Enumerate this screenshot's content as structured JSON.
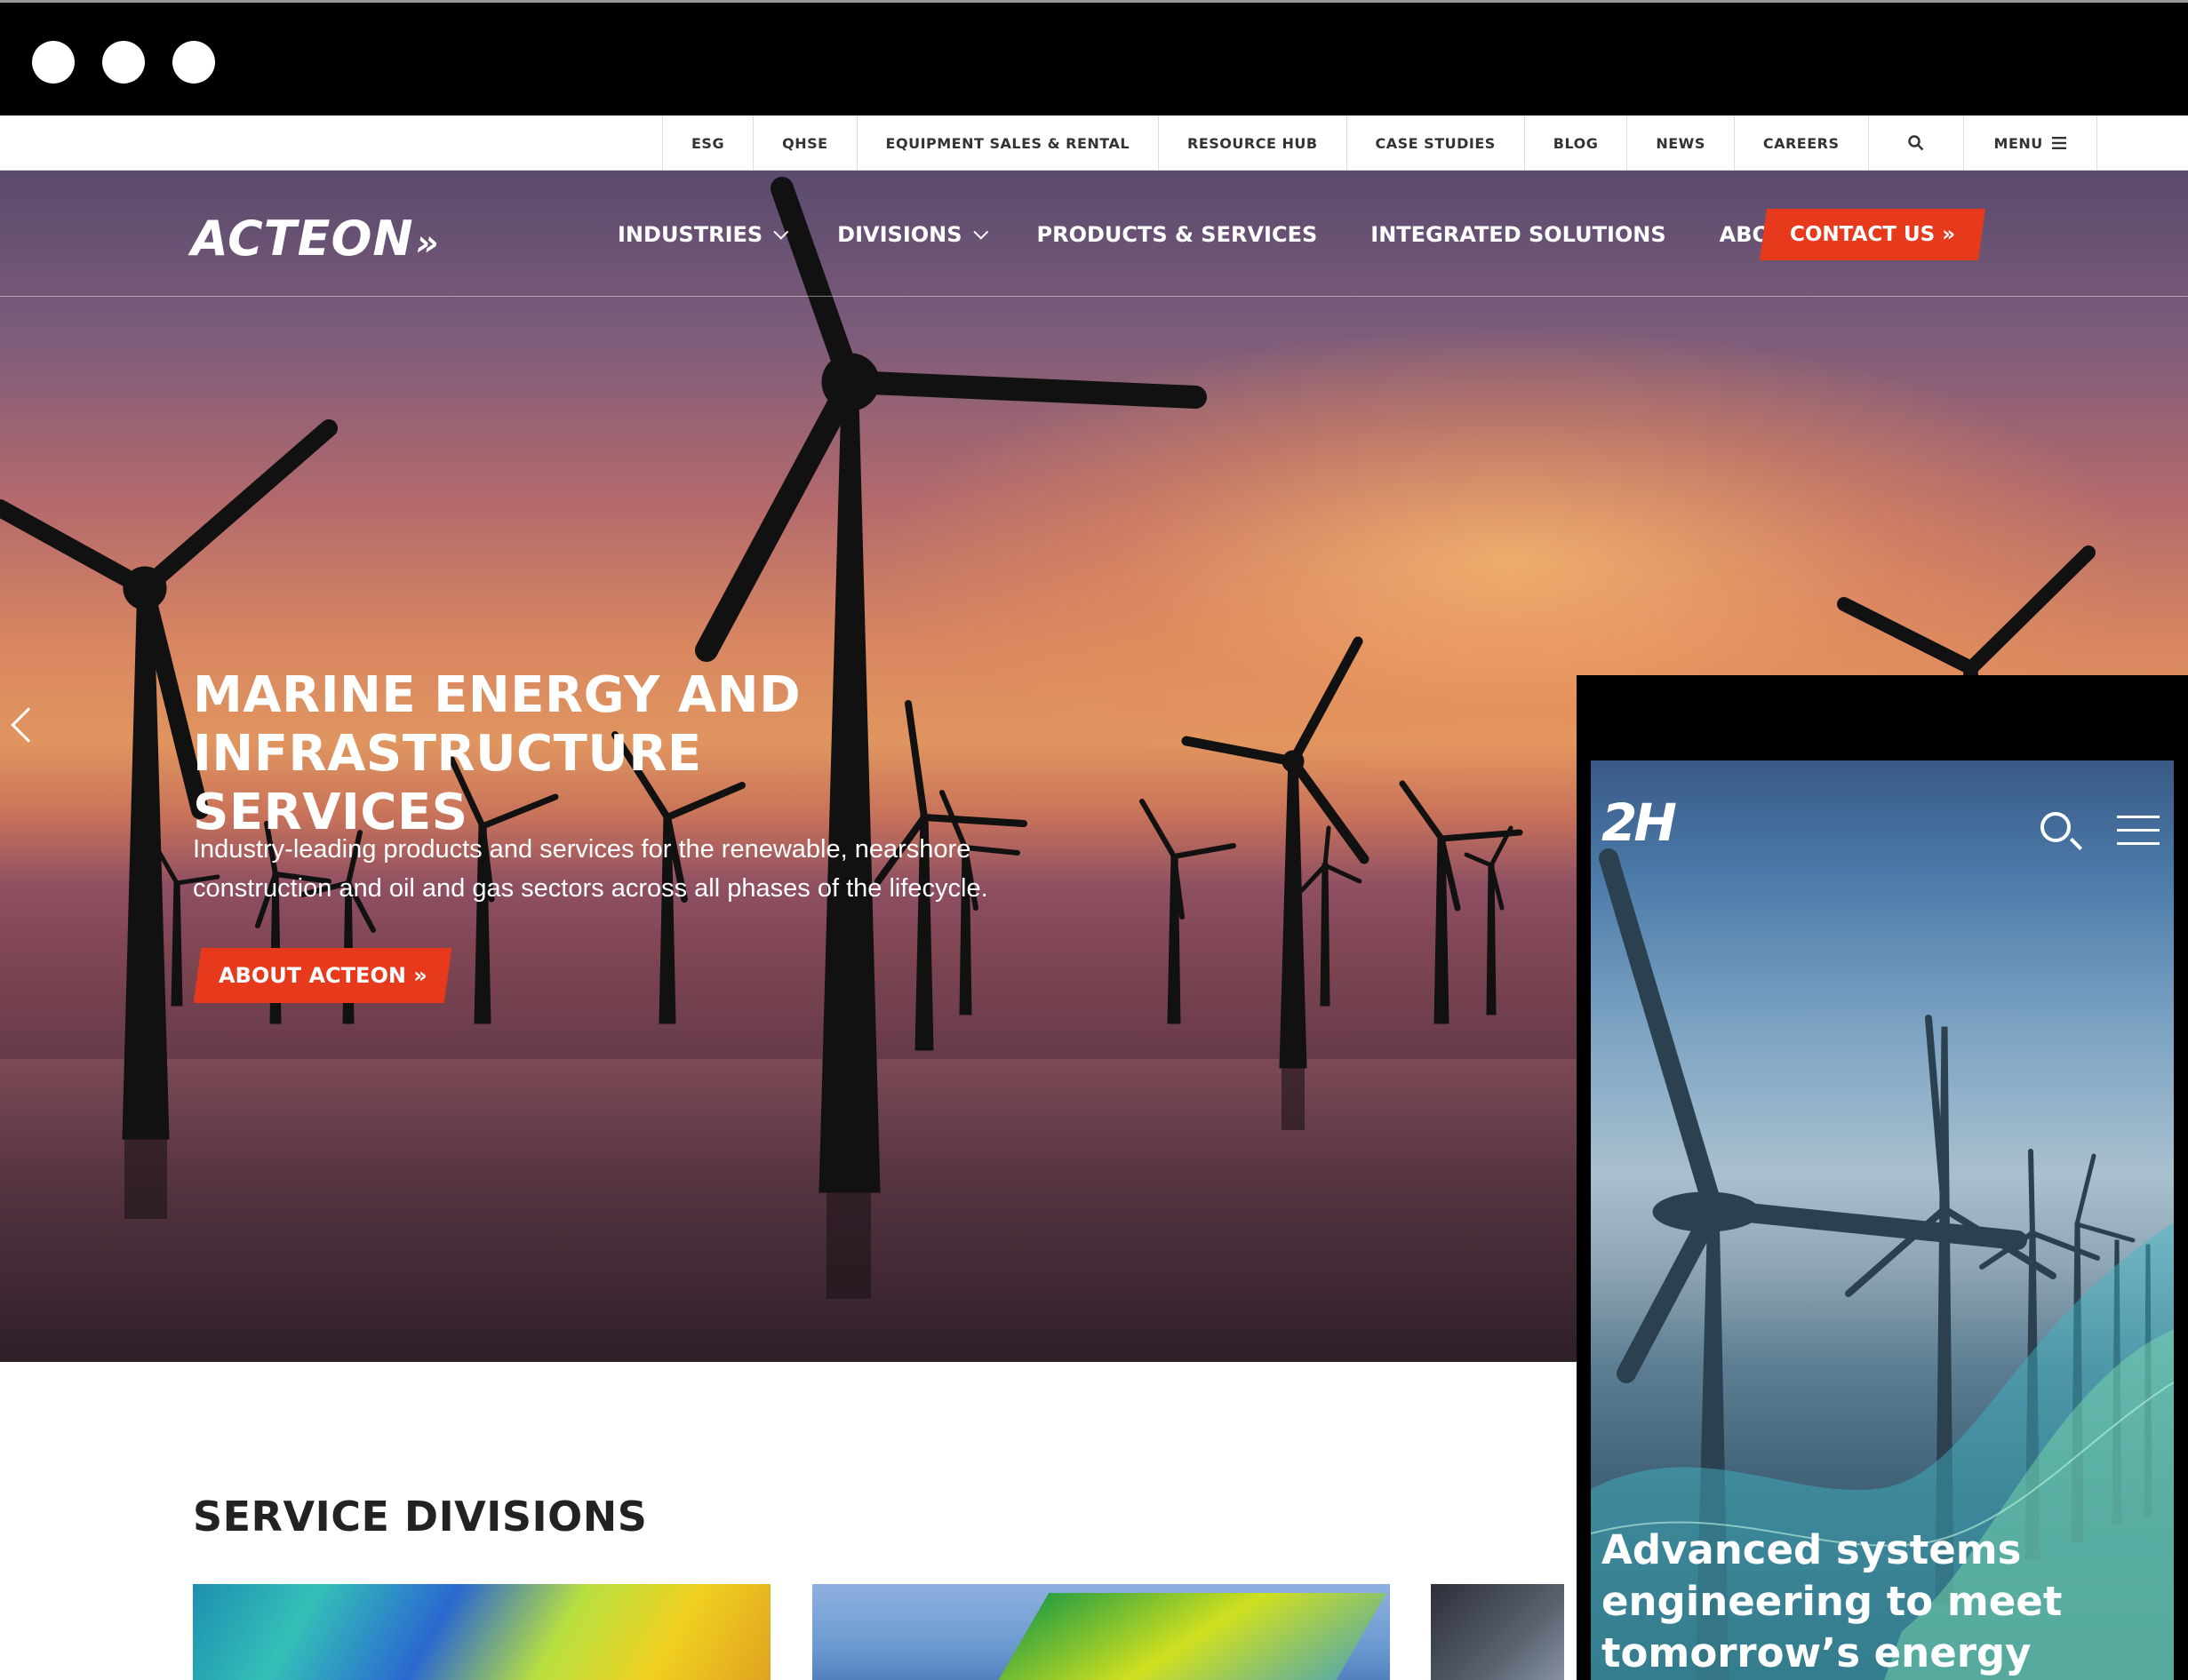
{
  "utility_nav": {
    "items": [
      "ESG",
      "QHSE",
      "EQUIPMENT SALES & RENTAL",
      "RESOURCE HUB",
      "CASE STUDIES",
      "BLOG",
      "NEWS",
      "CAREERS"
    ],
    "search_icon": "search-icon",
    "menu_label": "MENU",
    "menu_icon": "hamburger-icon"
  },
  "main_nav": {
    "logo": "ACTEON",
    "links": [
      {
        "label": "INDUSTRIES",
        "dropdown": true
      },
      {
        "label": "DIVISIONS",
        "dropdown": true
      },
      {
        "label": "PRODUCTS & SERVICES",
        "dropdown": false
      },
      {
        "label": "INTEGRATED SOLUTIONS",
        "dropdown": false
      },
      {
        "label": "ABOUT ACTEON",
        "dropdown": true
      }
    ],
    "contact_label": "CONTACT US »"
  },
  "hero": {
    "title_line1": "MARINE ENERGY AND",
    "title_line2": "INFRASTRUCTURE SERVICES",
    "subtitle_line1": "Industry-leading products and services for the renewable, nearshore",
    "subtitle_line2": "construction and oil and gas sectors across all phases of the lifecycle.",
    "button_label": "ABOUT ACTEON »"
  },
  "services": {
    "title": "SERVICE DIVISIONS"
  },
  "mobile": {
    "logo": "2H",
    "title_line1": "Advanced systems",
    "title_line2": "engineering to meet",
    "title_line3": "tomorrow’s energy"
  },
  "colors": {
    "accent": "#e73a1d",
    "chrome": "#000000"
  }
}
